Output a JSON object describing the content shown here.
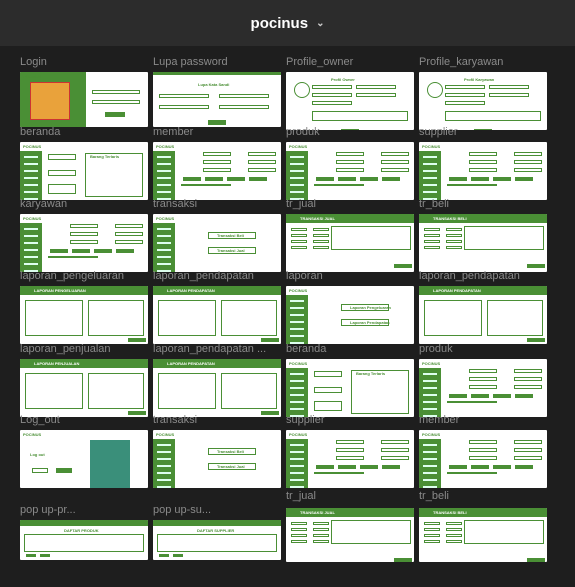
{
  "app": {
    "title": "pocinus"
  },
  "frames": [
    {
      "id": "login",
      "label": "Login",
      "hint": "Selamat Datang!",
      "btn": "Login"
    },
    {
      "id": "lupa",
      "label": "Lupa password",
      "hint": "Lupa Kata Sandi",
      "btn": "Simpan"
    },
    {
      "id": "po",
      "label": "Profile_owner",
      "hint": "Profil Owner",
      "btn": "Simpan"
    },
    {
      "id": "pk",
      "label": "Profile_karyawan",
      "hint": "Profil Karyawan",
      "btn": "Simpan"
    },
    {
      "id": "beranda",
      "label": "beranda",
      "hint": "Barang Terlaris"
    },
    {
      "id": "member",
      "label": "member",
      "hint": ""
    },
    {
      "id": "produk",
      "label": "produk",
      "hint": ""
    },
    {
      "id": "supplier",
      "label": "supplier",
      "hint": ""
    },
    {
      "id": "karyawan",
      "label": "karyawan",
      "hint": ""
    },
    {
      "id": "transaksi",
      "label": "transaksi",
      "hint": "Transaksi Beli",
      "hint2": "Transaksi Jual"
    },
    {
      "id": "trjual",
      "label": "tr_jual",
      "hint": "TRANSAKSI JUAL"
    },
    {
      "id": "trbeli",
      "label": "tr_beli",
      "hint": "TRANSAKSI BELI"
    },
    {
      "id": "lappeng",
      "label": "laporan_pengeluaran",
      "hint": "LAPORAN PENGELUARAN"
    },
    {
      "id": "lappend",
      "label": "laporan_pendapatan",
      "hint": "LAPORAN PENDAPATAN"
    },
    {
      "id": "laporan",
      "label": "laporan",
      "hint": "Laporan Pengeluaran",
      "hint2": "Laporan Pendapatan"
    },
    {
      "id": "lappend2",
      "label": "laporan_pendapatan",
      "hint": "LAPORAN PENDAPATAN"
    },
    {
      "id": "lappenj",
      "label": "laporan_penjualan",
      "hint": "LAPORAN PENJUALAN"
    },
    {
      "id": "lappenda",
      "label": "laporan_pendapatan ...",
      "hint": "LAPORAN PENDAPATAN"
    },
    {
      "id": "beranda2",
      "label": "beranda",
      "hint": "Barang Terlaris"
    },
    {
      "id": "produk2",
      "label": "produk",
      "hint": ""
    },
    {
      "id": "logout",
      "label": "Log_out",
      "hint": "Log out",
      "btn": "Keluar"
    },
    {
      "id": "transaksi2",
      "label": "transaksi",
      "hint": "Transaksi Beli",
      "hint2": "Transaksi Jual"
    },
    {
      "id": "supplier2",
      "label": "supplier",
      "hint": ""
    },
    {
      "id": "member2",
      "label": "member",
      "hint": ""
    },
    {
      "id": "popup1",
      "label": "pop up-pr...",
      "hint": "DAFTAR PRODUK"
    },
    {
      "id": "popup2",
      "label": "pop up-su...",
      "hint": "DAFTAR SUPPLIER"
    },
    {
      "id": "trjual2",
      "label": "tr_jual",
      "hint": "TRANSAKSI JUAL"
    },
    {
      "id": "trbeli2",
      "label": "tr_beli",
      "hint": "TRANSAKSI BELI"
    }
  ],
  "brand": {
    "logo": "POCINUS",
    "green": "#4a8f35"
  }
}
